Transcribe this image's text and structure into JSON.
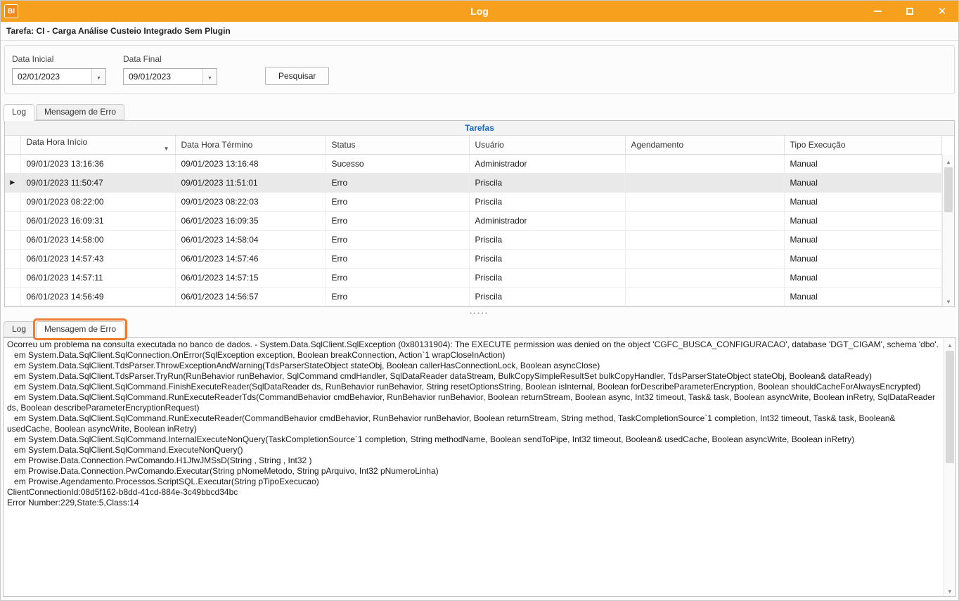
{
  "colors": {
    "titlebar": "#F7A01E",
    "highlight": "#ED7D31",
    "caption-blue": "#1565C0",
    "selected-row": "#E9E9E9"
  },
  "window": {
    "title": "Log",
    "icon_text": "BI"
  },
  "header": {
    "task": "Tarefa: CI - Carga Análise Custeio Integrado Sem Plugin"
  },
  "filters": {
    "start_label": "Data Inicial",
    "start_value": "02/01/2023",
    "end_label": "Data Final",
    "end_value": "09/01/2023",
    "search_button": "Pesquisar"
  },
  "tabs": {
    "top": [
      {
        "label": "Log",
        "active": true
      },
      {
        "label": "Mensagem de Erro",
        "active": false
      }
    ],
    "bottom": [
      {
        "label": "Log",
        "active": false
      },
      {
        "label": "Mensagem de Erro",
        "active": true,
        "highlighted": true
      }
    ]
  },
  "table": {
    "title": "Tarefas",
    "columns": [
      {
        "label": "Data Hora Início",
        "sort": "desc"
      },
      {
        "label": "Data Hora Término"
      },
      {
        "label": "Status"
      },
      {
        "label": "Usuário"
      },
      {
        "label": "Agendamento"
      },
      {
        "label": "Tipo Execução"
      }
    ],
    "rows": [
      {
        "indicator": "",
        "inicio": "09/01/2023 13:16:36",
        "termino": "09/01/2023 13:16:48",
        "status": "Sucesso",
        "usuario": "Administrador",
        "agendamento": "",
        "execucao": "Manual",
        "selected": false
      },
      {
        "indicator": "▶",
        "inicio": "09/01/2023 11:50:47",
        "termino": "09/01/2023 11:51:01",
        "status": "Erro",
        "usuario": "Priscila",
        "agendamento": "",
        "execucao": "Manual",
        "selected": true
      },
      {
        "indicator": "",
        "inicio": "09/01/2023 08:22:00",
        "termino": "09/01/2023 08:22:03",
        "status": "Erro",
        "usuario": "Priscila",
        "agendamento": "",
        "execucao": "Manual",
        "selected": false
      },
      {
        "indicator": "",
        "inicio": "06/01/2023 16:09:31",
        "termino": "06/01/2023 16:09:35",
        "status": "Erro",
        "usuario": "Administrador",
        "agendamento": "",
        "execucao": "Manual",
        "selected": false
      },
      {
        "indicator": "",
        "inicio": "06/01/2023 14:58:00",
        "termino": "06/01/2023 14:58:04",
        "status": "Erro",
        "usuario": "Priscila",
        "agendamento": "",
        "execucao": "Manual",
        "selected": false
      },
      {
        "indicator": "",
        "inicio": "06/01/2023 14:57:43",
        "termino": "06/01/2023 14:57:46",
        "status": "Erro",
        "usuario": "Priscila",
        "agendamento": "",
        "execucao": "Manual",
        "selected": false
      },
      {
        "indicator": "",
        "inicio": "06/01/2023 14:57:11",
        "termino": "06/01/2023 14:57:15",
        "status": "Erro",
        "usuario": "Priscila",
        "agendamento": "",
        "execucao": "Manual",
        "selected": false
      },
      {
        "indicator": "",
        "inicio": "06/01/2023 14:56:49",
        "termino": "06/01/2023 14:56:57",
        "status": "Erro",
        "usuario": "Priscila",
        "agendamento": "",
        "execucao": "Manual",
        "selected": false
      }
    ]
  },
  "error_message": {
    "lines": [
      "Ocorreu um problema na consulta executada no banco de dados. - System.Data.SqlClient.SqlException (0x80131904): The EXECUTE permission was denied on the object 'CGFC_BUSCA_CONFIGURACAO', database 'DGT_CIGAM', schema 'dbo'.",
      "   em System.Data.SqlClient.SqlConnection.OnError(SqlException exception, Boolean breakConnection, Action`1 wrapCloseInAction)",
      "   em System.Data.SqlClient.TdsParser.ThrowExceptionAndWarning(TdsParserStateObject stateObj, Boolean callerHasConnectionLock, Boolean asyncClose)",
      "   em System.Data.SqlClient.TdsParser.TryRun(RunBehavior runBehavior, SqlCommand cmdHandler, SqlDataReader dataStream, BulkCopySimpleResultSet bulkCopyHandler, TdsParserStateObject stateObj, Boolean& dataReady)",
      "   em System.Data.SqlClient.SqlCommand.FinishExecuteReader(SqlDataReader ds, RunBehavior runBehavior, String resetOptionsString, Boolean isInternal, Boolean forDescribeParameterEncryption, Boolean shouldCacheForAlwaysEncrypted)",
      "   em System.Data.SqlClient.SqlCommand.RunExecuteReaderTds(CommandBehavior cmdBehavior, RunBehavior runBehavior, Boolean returnStream, Boolean async, Int32 timeout, Task& task, Boolean asyncWrite, Boolean inRetry, SqlDataReader ds, Boolean describeParameterEncryptionRequest)",
      "   em System.Data.SqlClient.SqlCommand.RunExecuteReader(CommandBehavior cmdBehavior, RunBehavior runBehavior, Boolean returnStream, String method, TaskCompletionSource`1 completion, Int32 timeout, Task& task, Boolean& usedCache, Boolean asyncWrite, Boolean inRetry)",
      "   em System.Data.SqlClient.SqlCommand.InternalExecuteNonQuery(TaskCompletionSource`1 completion, String methodName, Boolean sendToPipe, Int32 timeout, Boolean& usedCache, Boolean asyncWrite, Boolean inRetry)",
      "   em System.Data.SqlClient.SqlCommand.ExecuteNonQuery()",
      "   em Prowise.Data.Connection.PwComando.H1JfwJMSsD(String , String , Int32 )",
      "   em Prowise.Data.Connection.PwComando.Executar(String pNomeMetodo, String pArquivo, Int32 pNumeroLinha)",
      "   em Prowise.Agendamento.Processos.ScriptSQL.Executar(String pTipoExecucao)",
      "ClientConnectionId:08d5f162-b8dd-41cd-884e-3c49bbcd34bc",
      "Error Number:229,State:5,Class:14"
    ]
  }
}
